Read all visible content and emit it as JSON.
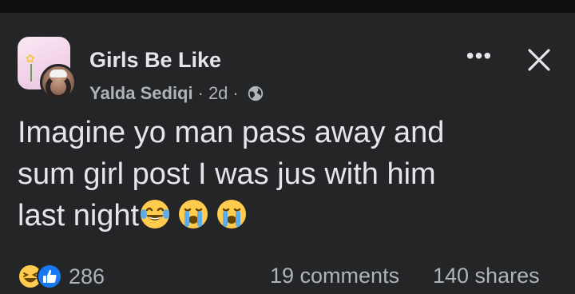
{
  "post": {
    "group_name": "Girls Be Like",
    "author": "Yalda Sediqi",
    "separator": "·",
    "time": "2d",
    "audience_icon": "globe-icon",
    "text_lines": [
      "Imagine yo man pass away and",
      "sum girl post I was jus with him",
      "last night"
    ],
    "emojis": [
      "laughing-tears-emoji",
      "loudly-crying-emoji",
      "loudly-crying-emoji"
    ]
  },
  "header_actions": {
    "more_label": "•••",
    "close_icon": "close-icon"
  },
  "footer": {
    "reaction_icons": [
      "haha-reaction-icon",
      "like-reaction-icon"
    ],
    "reaction_count": "286",
    "comments": "19 comments",
    "shares": "140 shares"
  },
  "colors": {
    "background": "#242526",
    "text_primary": "#e4e6eb",
    "text_secondary": "#b0b3b8",
    "like_blue": "#1877f2",
    "emoji_yellow": "#ffcc4d"
  }
}
